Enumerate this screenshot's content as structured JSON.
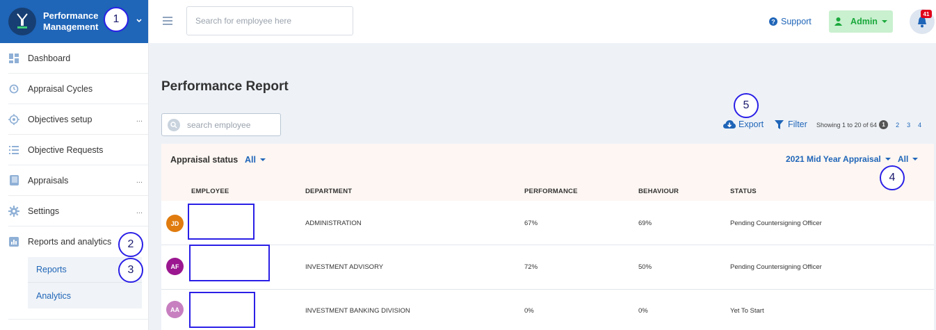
{
  "app": {
    "title_line1": "Performance",
    "title_line2": "Management"
  },
  "topbar": {
    "search_placeholder": "Search for employee here",
    "support_label": "Support",
    "admin_label": "Admin",
    "notification_count": "41"
  },
  "sidebar": {
    "items": [
      {
        "label": "Dashboard",
        "icon": "dashboard-icon"
      },
      {
        "label": "Appraisal Cycles",
        "icon": "cycle-icon"
      },
      {
        "label": "Objectives setup",
        "icon": "target-icon",
        "more": "..."
      },
      {
        "label": "Objective Requests",
        "icon": "list-icon"
      },
      {
        "label": "Appraisals",
        "icon": "book-icon",
        "more": "..."
      },
      {
        "label": "Settings",
        "icon": "gear-icon",
        "more": "..."
      },
      {
        "label": "Reports and analytics",
        "icon": "chart-icon"
      }
    ],
    "submenu": [
      {
        "label": "Reports"
      },
      {
        "label": "Analytics"
      }
    ]
  },
  "main": {
    "title": "Performance Report",
    "search_placeholder": "search employee",
    "export_label": "Export",
    "filter_label": "Filter",
    "showing_text": "Showing 1 to 20 of 64",
    "pages": [
      "1",
      "2",
      "3",
      "4"
    ],
    "appraisal_status_label": "Appraisal status",
    "appraisal_status_value": "All",
    "cycle_value": "2021 Mid Year Appraisal",
    "cycle_filter_value": "All",
    "columns": [
      "EMPLOYEE",
      "DEPARTMENT",
      "PERFORMANCE",
      "BEHAVIOUR",
      "STATUS"
    ],
    "rows": [
      {
        "initials": "JD",
        "avatar_color": "#e07b0f",
        "department": "ADMINISTRATION",
        "performance": "67%",
        "behaviour": "69%",
        "status": "Pending Countersigning Officer"
      },
      {
        "initials": "AF",
        "avatar_color": "#9b1790",
        "department": "INVESTMENT ADVISORY",
        "performance": "72%",
        "behaviour": "50%",
        "status": "Pending Countersigning Officer"
      },
      {
        "initials": "AA",
        "avatar_color": "#c77fc0",
        "department": "INVESTMENT BANKING DIVISION",
        "performance": "0%",
        "behaviour": "0%",
        "status": "Yet To Start"
      }
    ]
  },
  "annotations": [
    "1",
    "2",
    "3",
    "4",
    "5"
  ],
  "colors": {
    "brand": "#1f65b8",
    "annotation": "#2a1fe6",
    "admin_bg": "#c9f0cf",
    "admin_text": "#1aa83b"
  }
}
